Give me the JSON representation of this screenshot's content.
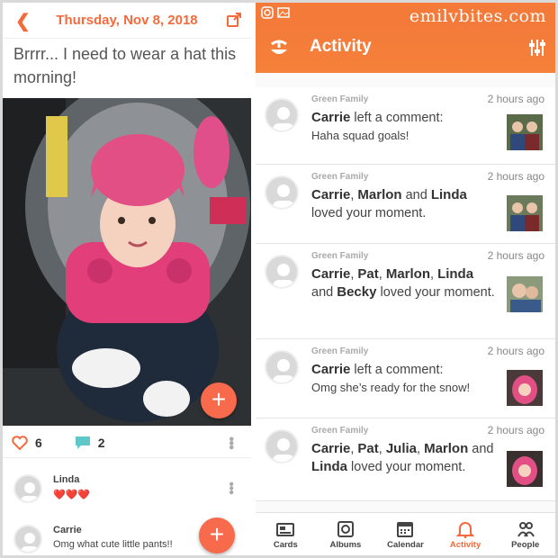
{
  "left": {
    "header": {
      "title": "Thursday, Nov 8, 2018"
    },
    "caption": "Brrrr... I need to wear a hat this morning!",
    "stats": {
      "likes": "6",
      "comments": "2"
    },
    "comments": [
      {
        "name": "Linda",
        "text": "❤️❤️❤️"
      },
      {
        "name": "Carrie",
        "text": "Omg what cute little pants!!"
      }
    ]
  },
  "right": {
    "brand": "emilybites.com",
    "header": {
      "title": "Activity"
    },
    "items": [
      {
        "group": "Green Family",
        "time": "2 hours ago",
        "who": "Carrie",
        "mid": " left a comment:",
        "detail": "Haha squad goals!"
      },
      {
        "group": "Green Family",
        "time": "2 hours ago",
        "names": [
          "Carrie",
          "Marlon",
          "Linda"
        ],
        "text": "loved your moment."
      },
      {
        "group": "Green Family",
        "time": "2 hours ago",
        "names": [
          "Carrie",
          "Pat",
          "Marlon",
          "Linda",
          "Becky"
        ],
        "text": "loved your moment."
      },
      {
        "group": "Green Family",
        "time": "2 hours ago",
        "who": "Carrie",
        "mid": " left a comment:",
        "detail": "Omg she’s ready for the snow!"
      },
      {
        "group": "Green Family",
        "time": "2 hours ago",
        "names": [
          "Carrie",
          "Pat",
          "Julia",
          "Marlon",
          "Linda"
        ],
        "text": "loved your moment."
      }
    ],
    "tabs": [
      {
        "label": "Cards",
        "icon": "cards-icon"
      },
      {
        "label": "Albums",
        "icon": "albums-icon"
      },
      {
        "label": "Calendar",
        "icon": "calendar-icon"
      },
      {
        "label": "Activity",
        "icon": "bell-icon",
        "active": true
      },
      {
        "label": "People",
        "icon": "people-icon"
      }
    ]
  },
  "colors": {
    "accent": "#f26a3d",
    "fab": "#f76a4c",
    "header": "#f47a3a"
  }
}
